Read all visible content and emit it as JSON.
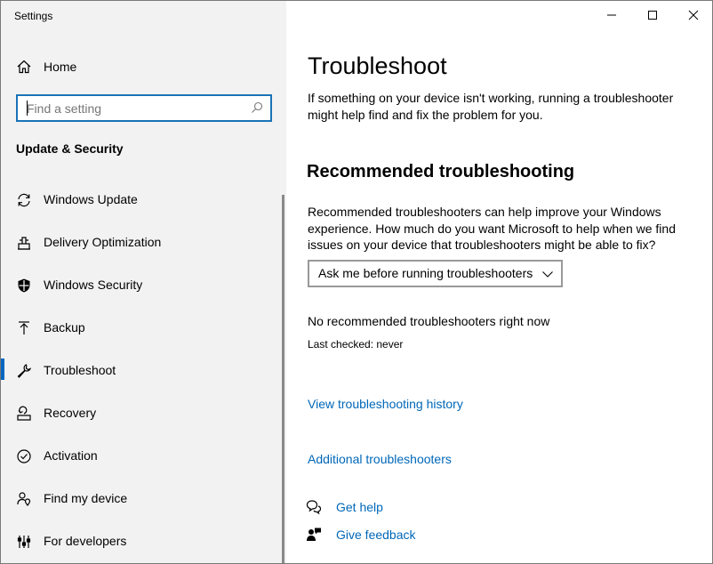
{
  "window": {
    "title": "Settings",
    "controls": {
      "minimize": "minimize",
      "maximize": "maximize",
      "close": "close"
    }
  },
  "sidebar": {
    "home_label": "Home",
    "search": {
      "placeholder": "Find a setting"
    },
    "section_title": "Update & Security",
    "items": [
      {
        "label": "Windows Update",
        "icon": "sync-icon"
      },
      {
        "label": "Delivery Optimization",
        "icon": "delivery-optimization-icon"
      },
      {
        "label": "Windows Security",
        "icon": "shield-icon"
      },
      {
        "label": "Backup",
        "icon": "backup-arrow-icon"
      },
      {
        "label": "Troubleshoot",
        "icon": "wrench-icon",
        "selected": true
      },
      {
        "label": "Recovery",
        "icon": "recovery-icon"
      },
      {
        "label": "Activation",
        "icon": "check-circle-icon"
      },
      {
        "label": "Find my device",
        "icon": "person-location-icon"
      },
      {
        "label": "For developers",
        "icon": "developer-sliders-icon"
      }
    ]
  },
  "main": {
    "title": "Troubleshoot",
    "intro": "If something on your device isn't working, running a troubleshooter might help find and fix the problem for you.",
    "recommended_heading": "Recommended troubleshooting",
    "recommended_desc": "Recommended troubleshooters can help improve your Windows experience. How much do you want Microsoft to help when we find issues on your device that troubleshooters might be able to fix?",
    "dropdown_value": "Ask me before running troubleshooters",
    "status_text": "No recommended troubleshooters right now",
    "last_checked": "Last checked: never",
    "history_link": "View troubleshooting history",
    "additional_link": "Additional troubleshooters",
    "get_help": "Get help",
    "give_feedback": "Give feedback"
  },
  "colors": {
    "accent": "#0067b8",
    "sidebar_bg": "#f2f2f2",
    "selection_indicator": "#0067c0"
  }
}
